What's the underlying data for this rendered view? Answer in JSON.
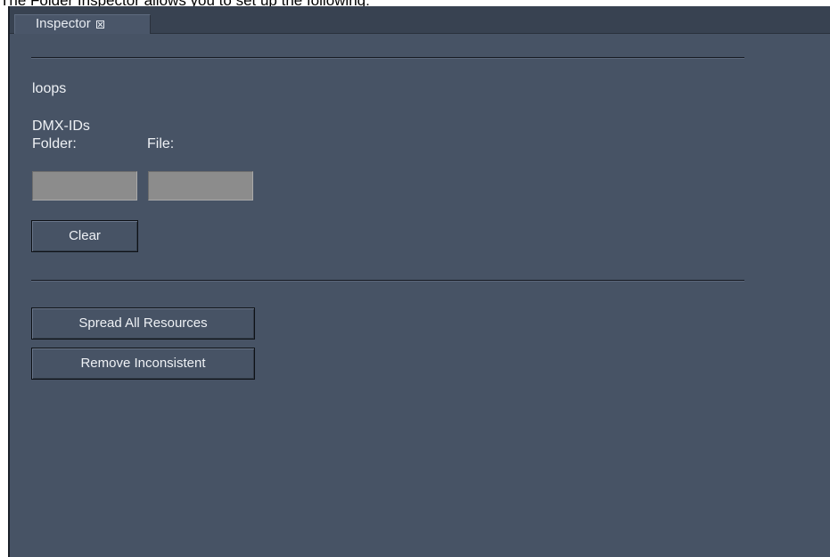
{
  "caption": "The Folder Inspector allows you to set up the following:",
  "tab": {
    "title": "Inspector",
    "close_icon": "close-box-icon"
  },
  "inspector": {
    "loops_label": "loops",
    "dmx_label": "DMX-IDs",
    "folder_label": "Folder:",
    "file_label": "File:",
    "folder_value": "",
    "file_value": "",
    "clear_button": "Clear",
    "spread_button": "Spread All Resources",
    "remove_button": "Remove Inconsistent"
  },
  "colors": {
    "panel_bg": "#475365",
    "tabbar_bg": "#384251",
    "field_bg": "#8c8c8c",
    "text": "#eef1f5"
  }
}
